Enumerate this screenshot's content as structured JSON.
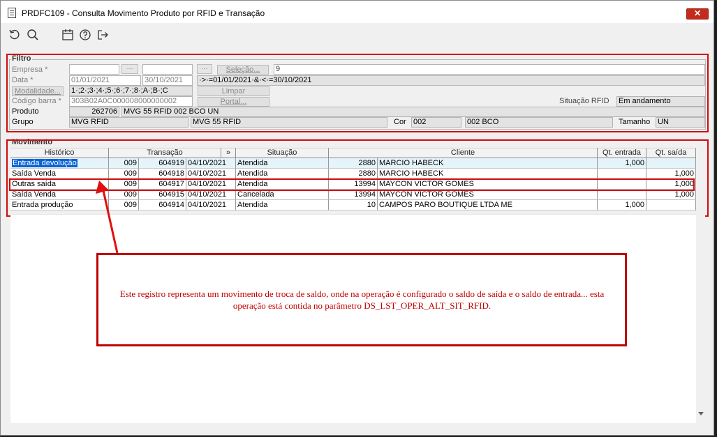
{
  "window": {
    "title": "PRDFC109 - Consulta Movimento Produto por RFID e Transação"
  },
  "toolbar": {
    "icons": [
      "refresh-icon",
      "search-icon",
      "calendar-icon",
      "help-icon",
      "exit-icon"
    ]
  },
  "filtro": {
    "legend": "Filtro",
    "empresa_label": "Empresa *",
    "empresa_dots": "···",
    "selecao_label": "Seleção...",
    "selecao_value": "9",
    "data_label": "Data *",
    "data_from": "01/01/2021",
    "data_to": "30/10/2021",
    "data_dots": "···",
    "data_expr": "·>·=01/01/2021·&·<·=30/10/2021",
    "modalidade_label": "Modalidade...",
    "modalidade_value": "1·;2·;3·;4·;5·;6·;7·;8·;A·;B·;C",
    "limpar_label": "Limpar",
    "codigo_label": "Código barra *",
    "codigo_value": "303B02A0C000008000000002",
    "portal_label": "Portal...",
    "situacao_label": "Situação RFID",
    "situacao_value": "Em andamento",
    "produto_label": "Produto",
    "produto_code": "262706",
    "produto_desc": "MVG 55 RFID 002 BCO UN",
    "grupo_label": "Grupo",
    "grupo_value1": "MVG RFID",
    "grupo_value2": "MVG 55 RFID",
    "cor_label": "Cor",
    "cor_code": "002",
    "cor_desc": "002 BCO",
    "tamanho_label": "Tamanho",
    "tamanho_value": "UN"
  },
  "movimento": {
    "legend": "Movimento",
    "headers": [
      "Histórico",
      "Transação",
      "»",
      "Situação",
      "Cliente",
      "Qt. entrada",
      "Qt. saída"
    ],
    "rows": [
      {
        "historico": "Entrada devolução",
        "t1": "009",
        "t2": "604919",
        "data": "04/10/2021",
        "situacao": "Atendida",
        "cli_code": "2880",
        "cliente": "MARCIO HABECK",
        "qt_entrada": "1,000",
        "qt_saida": ""
      },
      {
        "historico": "Saída Venda",
        "t1": "009",
        "t2": "604918",
        "data": "04/10/2021",
        "situacao": "Atendida",
        "cli_code": "2880",
        "cliente": "MARCIO HABECK",
        "qt_entrada": "",
        "qt_saida": "1,000"
      },
      {
        "historico": "Outras saída",
        "t1": "009",
        "t2": "604917",
        "data": "04/10/2021",
        "situacao": "Atendida",
        "cli_code": "13994",
        "cliente": "MAYCON VICTOR GOMES",
        "qt_entrada": "",
        "qt_saida": "1,000"
      },
      {
        "historico": "Saída Venda",
        "t1": "009",
        "t2": "604915",
        "data": "04/10/2021",
        "situacao": "Cancelada",
        "cli_code": "13994",
        "cliente": "MAYCON VICTOR GOMES",
        "qt_entrada": "",
        "qt_saida": "1,000"
      },
      {
        "historico": "Entrada produção",
        "t1": "009",
        "t2": "604914",
        "data": "04/10/2021",
        "situacao": "Atendida",
        "cli_code": "10",
        "cliente": "CAMPOS PARO BOUTIQUE LTDA ME",
        "qt_entrada": "1,000",
        "qt_saida": ""
      }
    ]
  },
  "annotation": {
    "text": "Este registro representa um movimento de troca de saldo, onde na operação é configurado o saldo de saída e o saldo de entrada... esta operação está contida no parâmetro DS_LST_OPER_ALT_SIT_RFID.",
    "color": "#c00000"
  },
  "colors": {
    "highlight": "#d20a0a",
    "selection": "#0a64d6",
    "close": "#c42b1c"
  }
}
